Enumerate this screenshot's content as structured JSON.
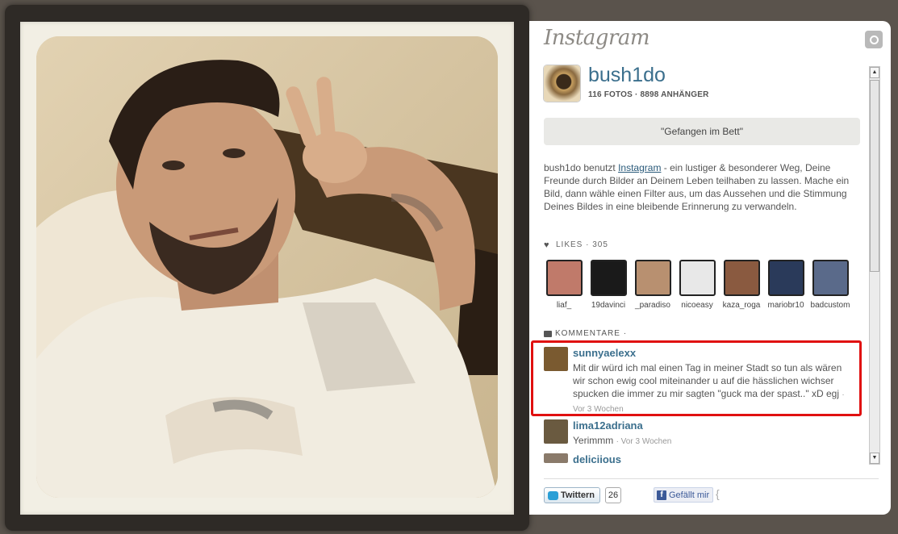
{
  "panel": {
    "logo": "Instagram",
    "camera_icon": "camera-icon"
  },
  "profile": {
    "username": "bush1do",
    "stats": "116 FOTOS · 8898 ANHÄNGER"
  },
  "caption": "\"Gefangen im Bett\"",
  "description": {
    "before_link": "bush1do benutzt ",
    "link": "Instagram",
    "after_link": " - ein lustiger & besonderer Weg, Deine Freunde durch Bilder an Deinem Leben teilhaben zu lassen. Mache ein Bild, dann wähle einen Filter aus, um das Aussehen und die Stimmung Deines Bildes in eine bleibende Erinnerung zu verwandeln."
  },
  "likes": {
    "header": "LIKES · 305",
    "users": [
      {
        "name": "liaf_",
        "color": "#c07a6a"
      },
      {
        "name": "19davinci",
        "color": "#1a1a1a"
      },
      {
        "name": "_paradiso",
        "color": "#b89070"
      },
      {
        "name": "nicoeasy",
        "color": "#e8e8e8"
      },
      {
        "name": "kaza_roga",
        "color": "#8a5a40"
      },
      {
        "name": "mariobr10",
        "color": "#2a3a5a"
      },
      {
        "name": "badcustom",
        "color": "#5a6a8a"
      }
    ]
  },
  "comments": {
    "header": "KOMMENTARE ·",
    "items": [
      {
        "user": "sunnyaelexx",
        "text": "Mit dir würd ich mal einen Tag in meiner Stadt so tun als wären wir schon ewig cool miteinander u auf die hässlichen wichser spucken die immer zu mir sagten \"guck ma der spast..\" xD egj",
        "time": "· Vor 3 Wochen",
        "color": "#7a5a30"
      },
      {
        "user": "lima12adriana",
        "text": "Yerimmm",
        "time": "· Vor 3 Wochen",
        "color": "#6a5a40"
      },
      {
        "user": "deliciious",
        "text": "",
        "time": "",
        "color": "#8a7a6a"
      }
    ]
  },
  "share": {
    "twitter_label": "Twittern",
    "twitter_count": "26",
    "facebook_label": "Gefällt mir",
    "facebook_icon": "f"
  }
}
